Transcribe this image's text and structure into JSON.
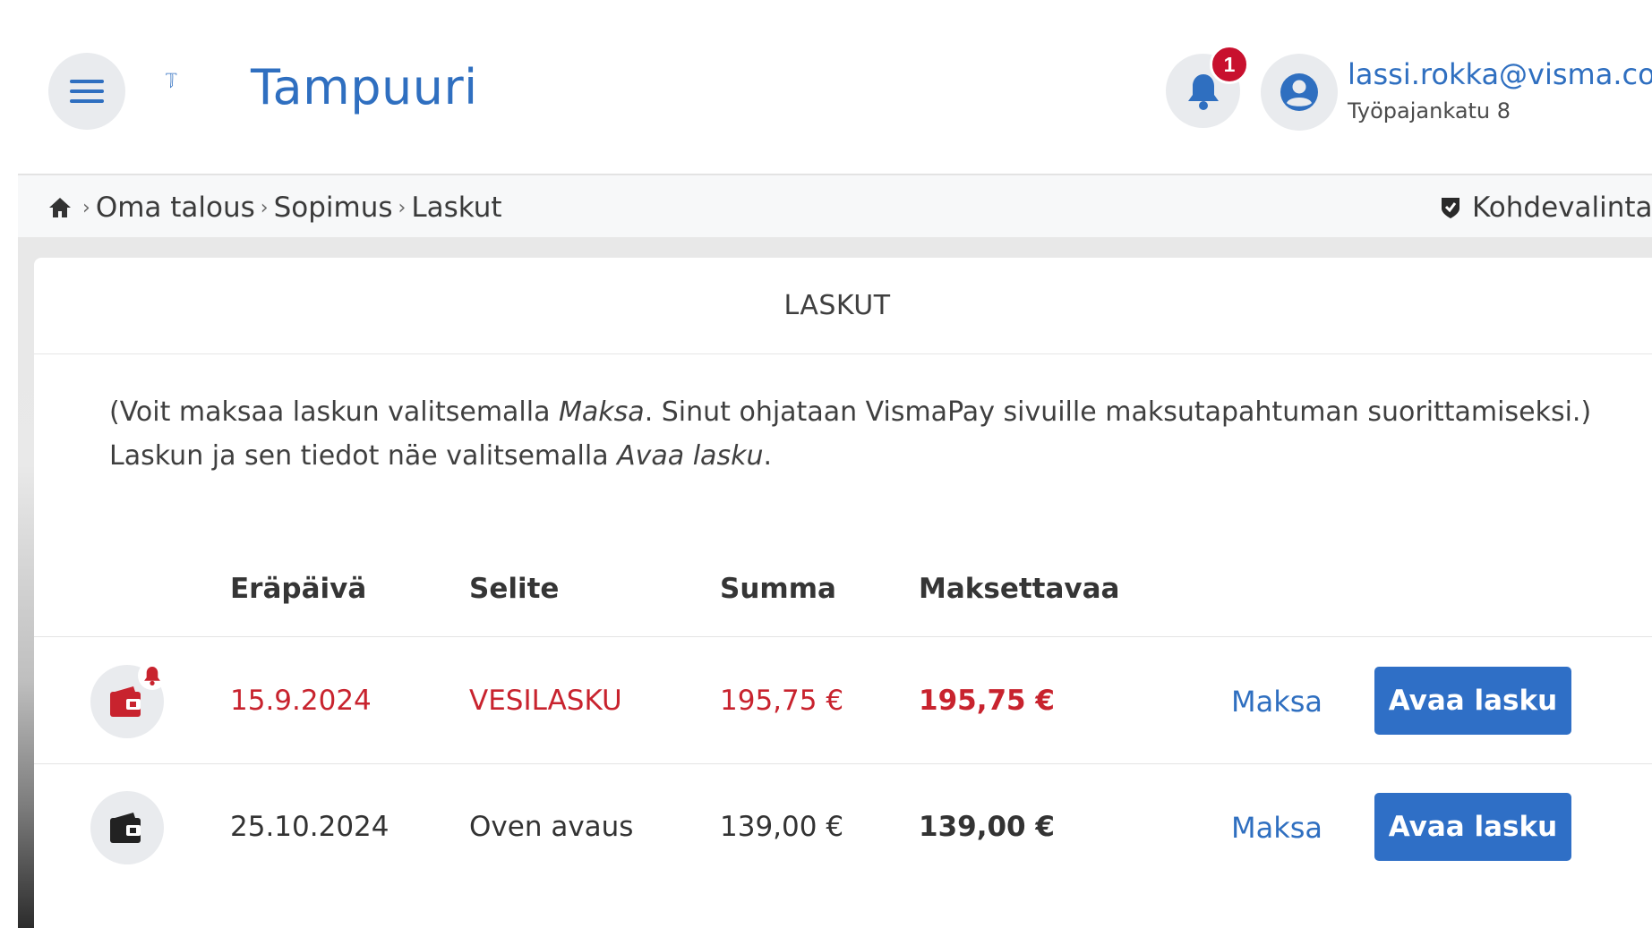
{
  "header": {
    "app_name": "Tampuuri",
    "notification_count": "1",
    "user_email": "lassi.rokka@visma.com",
    "user_address": "Työpajankatu 8"
  },
  "breadcrumb": {
    "items": [
      "Oma talous",
      "Sopimus",
      "Laskut"
    ],
    "separator": "›",
    "target_label": "Kohdevalinta"
  },
  "card": {
    "title": "LASKUT",
    "info_line1_pre": "(Voit maksaa laskun valitsemalla ",
    "info_line1_em": "Maksa",
    "info_line1_post": ". Sinut ohjataan VismaPay sivuille maksutapahtuman suorittamiseksi.)",
    "info_line2_pre": "Laskun ja sen tiedot näe valitsemalla ",
    "info_line2_em": "Avaa lasku",
    "info_line2_post": "."
  },
  "table": {
    "columns": [
      "Eräpäivä",
      "Selite",
      "Summa",
      "Maksettavaa"
    ],
    "rows": [
      {
        "due": "15.9.2024",
        "desc": "VESILASKU",
        "amount": "195,75 €",
        "payable": "195,75 €",
        "pay_label": "Maksa",
        "open_label": "Avaa lasku",
        "status": "overdue"
      },
      {
        "due": "25.10.2024",
        "desc": "Oven avaus",
        "amount": "139,00 €",
        "payable": "139,00 €",
        "pay_label": "Maksa",
        "open_label": "Avaa lasku",
        "status": "normal"
      }
    ]
  },
  "colors": {
    "brand": "#2f6fc0",
    "overdue": "#c8232e",
    "badge": "#c8102e",
    "button": "#2f6fc6"
  },
  "icons": {
    "menu": "hamburger-icon",
    "notifications": "bell-icon",
    "user": "user-circle-icon",
    "home": "home-icon",
    "target": "shield-check-icon",
    "invoice": "wallet-icon"
  }
}
